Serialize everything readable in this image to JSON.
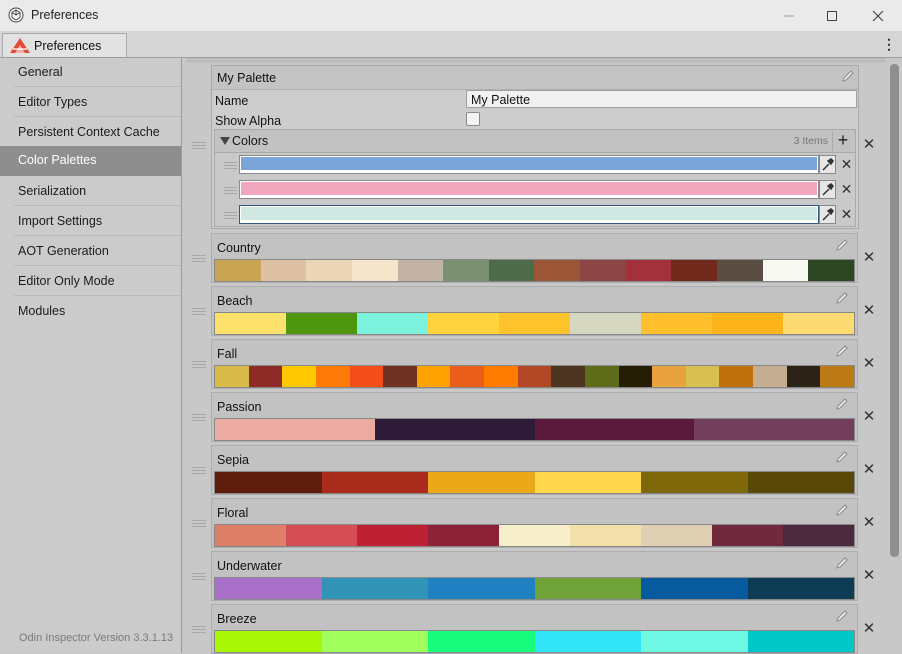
{
  "window": {
    "title": "Preferences"
  },
  "tab": {
    "label": "Preferences"
  },
  "sidebar": {
    "items": [
      {
        "label": "General"
      },
      {
        "label": "Editor Types"
      },
      {
        "label": "Persistent Context Cache"
      },
      {
        "label": "Color Palettes"
      },
      {
        "label": "Serialization"
      },
      {
        "label": "Import Settings"
      },
      {
        "label": "AOT Generation"
      },
      {
        "label": "Editor Only Mode"
      },
      {
        "label": "Modules"
      }
    ],
    "active": "Color Palettes",
    "version": "Odin Inspector Version 3.3.1.13"
  },
  "my_palette": {
    "title": "My Palette",
    "name_label": "Name",
    "name_value": "My Palette",
    "show_alpha_label": "Show Alpha",
    "show_alpha": false,
    "colors_label": "Colors",
    "count": "3 Items",
    "colors": [
      "#7aa5d8",
      "#f0a7bd",
      "#cfe8e2"
    ]
  },
  "palettes": [
    {
      "name": "Country",
      "colors": [
        "#c8a453",
        "#dec0a2",
        "#ead5b6",
        "#f5e6cb",
        "#c2b3a6",
        "#7a9070",
        "#4e6b4b",
        "#9b5537",
        "#8d4646",
        "#a2313b",
        "#70291b",
        "#5a4d41",
        "#f9f9f3",
        "#2c4722"
      ]
    },
    {
      "name": "Beach",
      "colors": [
        "#fde16d",
        "#4f960f",
        "#7cf2dd",
        "#fed33d",
        "#fdc32d",
        "#d6d7c0",
        "#fec12d",
        "#fdb31a",
        "#feda73"
      ]
    },
    {
      "name": "Fall",
      "colors": [
        "#d8ba48",
        "#8f2b26",
        "#fec900",
        "#fe7a06",
        "#f34e1a",
        "#6f3323",
        "#fea300",
        "#e95e1a",
        "#fe7b00",
        "#b34826",
        "#4b3520",
        "#5f6d1b",
        "#261d05",
        "#e9a33e",
        "#d7bf51",
        "#c0710d",
        "#c4ad91",
        "#2b2316",
        "#bb7a13"
      ]
    },
    {
      "name": "Passion",
      "colors": [
        "#ebaba1",
        "#2e1b37",
        "#5b1a3b",
        "#713e5c"
      ]
    },
    {
      "name": "Sepia",
      "colors": [
        "#5f1d0b",
        "#a92b1b",
        "#eba819",
        "#ffd74d",
        "#7d6708",
        "#584808"
      ]
    },
    {
      "name": "Floral",
      "colors": [
        "#de8068",
        "#d54e56",
        "#be2134",
        "#8c2138",
        "#f7efc9",
        "#f2e0ab",
        "#e0d0b3",
        "#6f2a3d",
        "#4a2a3c"
      ]
    },
    {
      "name": "Underwater",
      "colors": [
        "#a870c8",
        "#3193b6",
        "#1f81c1",
        "#70a23a",
        "#075a9e",
        "#0e3c54"
      ]
    },
    {
      "name": "Breeze",
      "colors": [
        "#a8f505",
        "#a1ff5d",
        "#17fc7d",
        "#30e3f5",
        "#6df8e4",
        "#00c7c8"
      ]
    }
  ]
}
